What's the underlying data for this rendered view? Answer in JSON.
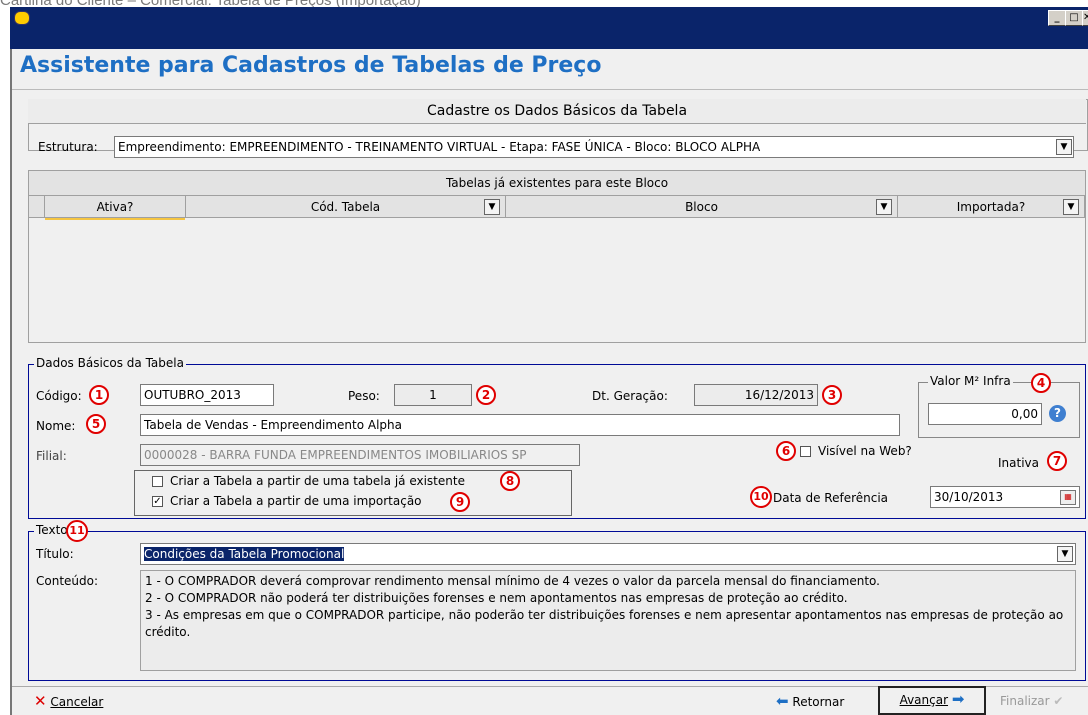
{
  "caption": "Cartilha do Cliente – Comercial: Tabela de Preços (Importação)",
  "window": {
    "title": "Assistente para Cadastros de Tabelas de Preço",
    "controls": {
      "minimize": "_",
      "maximize": "□",
      "close": "✕"
    }
  },
  "dados_section": {
    "title": "Cadastre os Dados Básicos da Tabela",
    "estrutura_label": "Estrutura:",
    "estrutura_value": "Empreendimento: EMPREENDIMENTO - TREINAMENTO VIRTUAL - Etapa: FASE ÚNICA - Bloco: BLOCO ALPHA"
  },
  "tables_grid": {
    "title": "Tabelas já existentes para este Bloco",
    "columns": [
      "Ativa?",
      "Cód. Tabela",
      "Bloco",
      "Importada?"
    ]
  },
  "basic_data": {
    "legend": "Dados Básicos da Tabela",
    "codigo_label": "Código:",
    "codigo_value": "OUTUBRO_2013",
    "peso_label": "Peso:",
    "peso_value": "1",
    "dt_geracao_label": "Dt. Geração:",
    "dt_geracao_value": "16/12/2013",
    "valor_legend": "Valor M² Infra",
    "valor_value": "0,00",
    "nome_label": "Nome:",
    "nome_value": "Tabela de Vendas - Empreendimento Alpha",
    "filial_label": "Filial:",
    "filial_value": "0000028 - BARRA FUNDA EMPREENDIMENTOS IMOBILIARIOS SP",
    "visivel_label": "Visível na Web?",
    "visivel_checked": false,
    "inativa_label": "Inativa",
    "criar_existente_label": "Criar a Tabela a partir de uma tabela já existente",
    "criar_existente_checked": false,
    "criar_importacao_label": "Criar a Tabela a partir de uma importação",
    "criar_importacao_checked": true,
    "data_ref_label": "Data de Referência",
    "data_ref_value": "30/10/2013"
  },
  "texto": {
    "legend": "Texto",
    "titulo_label": "Título:",
    "titulo_value": "Condições da Tabela Promocional",
    "conteudo_label": "Conteúdo:",
    "conteudo_value": "1 - O COMPRADOR deverá comprovar rendimento mensal mínimo de 4 vezes o valor da parcela mensal do financiamento.\n2 - O COMPRADOR não poderá ter distribuições forenses e nem apontamentos nas empresas de proteção ao crédito.\n3 - As empresas em que o COMPRADOR participe, não poderão ter distribuições forenses e nem apresentar apontamentos nas empresas de proteção ao crédito."
  },
  "badges": [
    "1",
    "2",
    "3",
    "4",
    "5",
    "6",
    "7",
    "8",
    "9",
    "10",
    "11"
  ],
  "footer": {
    "cancelar": "Cancelar",
    "retornar": "Retornar",
    "avancar": "Avançar",
    "finalizar": "Finalizar"
  },
  "colors": {
    "title_blue": "#1e6fc4",
    "titlebar": "#0a246a",
    "badge_red": "#e00000",
    "group_border": "#000a96"
  }
}
